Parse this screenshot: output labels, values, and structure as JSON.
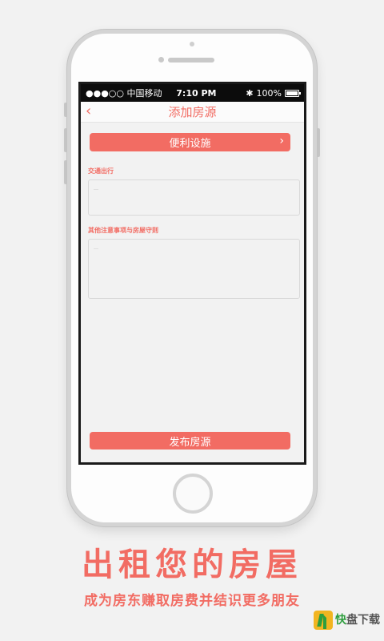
{
  "status_bar": {
    "carrier": "●●●○○ 中国移动",
    "time": "7:10 PM",
    "bluetooth": "✱",
    "battery_percent": "100%",
    "battery_level": 1.0
  },
  "nav": {
    "back_icon": "‹",
    "title": "添加房源"
  },
  "facility_button": {
    "label": "便利设施",
    "arrow": "›"
  },
  "traffic": {
    "label": "交通出行",
    "placeholder": "…"
  },
  "notes": {
    "label": "其他注意事项与房屋守则",
    "placeholder": "…"
  },
  "publish_button": {
    "label": "发布房源"
  },
  "promo": {
    "headline": "出租您的房屋",
    "subline": "成为房东赚取房费并结识更多朋友"
  },
  "watermark": {
    "name_green": "快",
    "name_rest": "盘下载"
  },
  "colors": {
    "accent": "#f26c63",
    "background": "#f2f2f2",
    "statusbar": "#0c0c0c"
  }
}
